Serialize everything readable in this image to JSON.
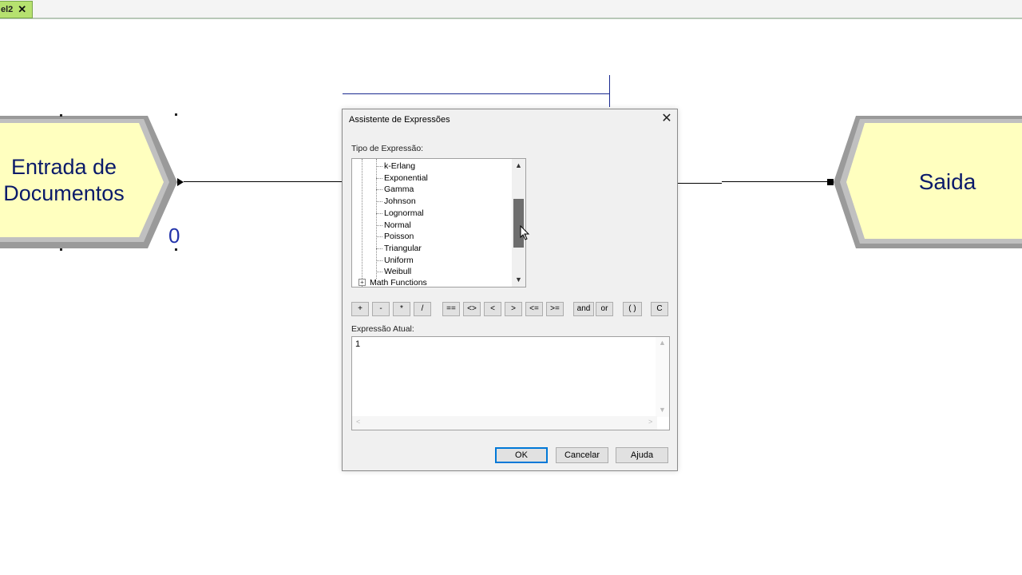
{
  "tab": {
    "label": "el2",
    "close": "✕"
  },
  "canvas": {
    "entry_module": {
      "line1": "Entrada de",
      "line2": "Documentos",
      "counter": "0"
    },
    "exit_module": {
      "label": "Saida"
    }
  },
  "dialog": {
    "title": "Assistente de Expressões",
    "close": "✕",
    "tipo_label": "Tipo de Expressão:",
    "tree_items": [
      "k-Erlang",
      "Exponential",
      "Gamma",
      "Johnson",
      "Lognormal",
      "Normal",
      "Poisson",
      "Triangular",
      "Uniform",
      "Weibull"
    ],
    "tree_parent": "Math Functions",
    "tree_plus": "+",
    "scroll_up": "▲",
    "scroll_down": "▼",
    "operators": [
      "+",
      "-",
      "*",
      "/",
      "==",
      "<>",
      "<",
      ">",
      "<=",
      ">=",
      "and",
      "or",
      "( )",
      "C"
    ],
    "expr_label": "Expressão Atual:",
    "expr_value": "1",
    "ok": "OK",
    "cancel": "Cancelar",
    "help": "Ajuda"
  },
  "colors": {
    "module_fill": "#ffffbf",
    "module_text": "#0a1a6a",
    "tab_green": "#b6e16f",
    "default_btn": "#0078d7"
  }
}
